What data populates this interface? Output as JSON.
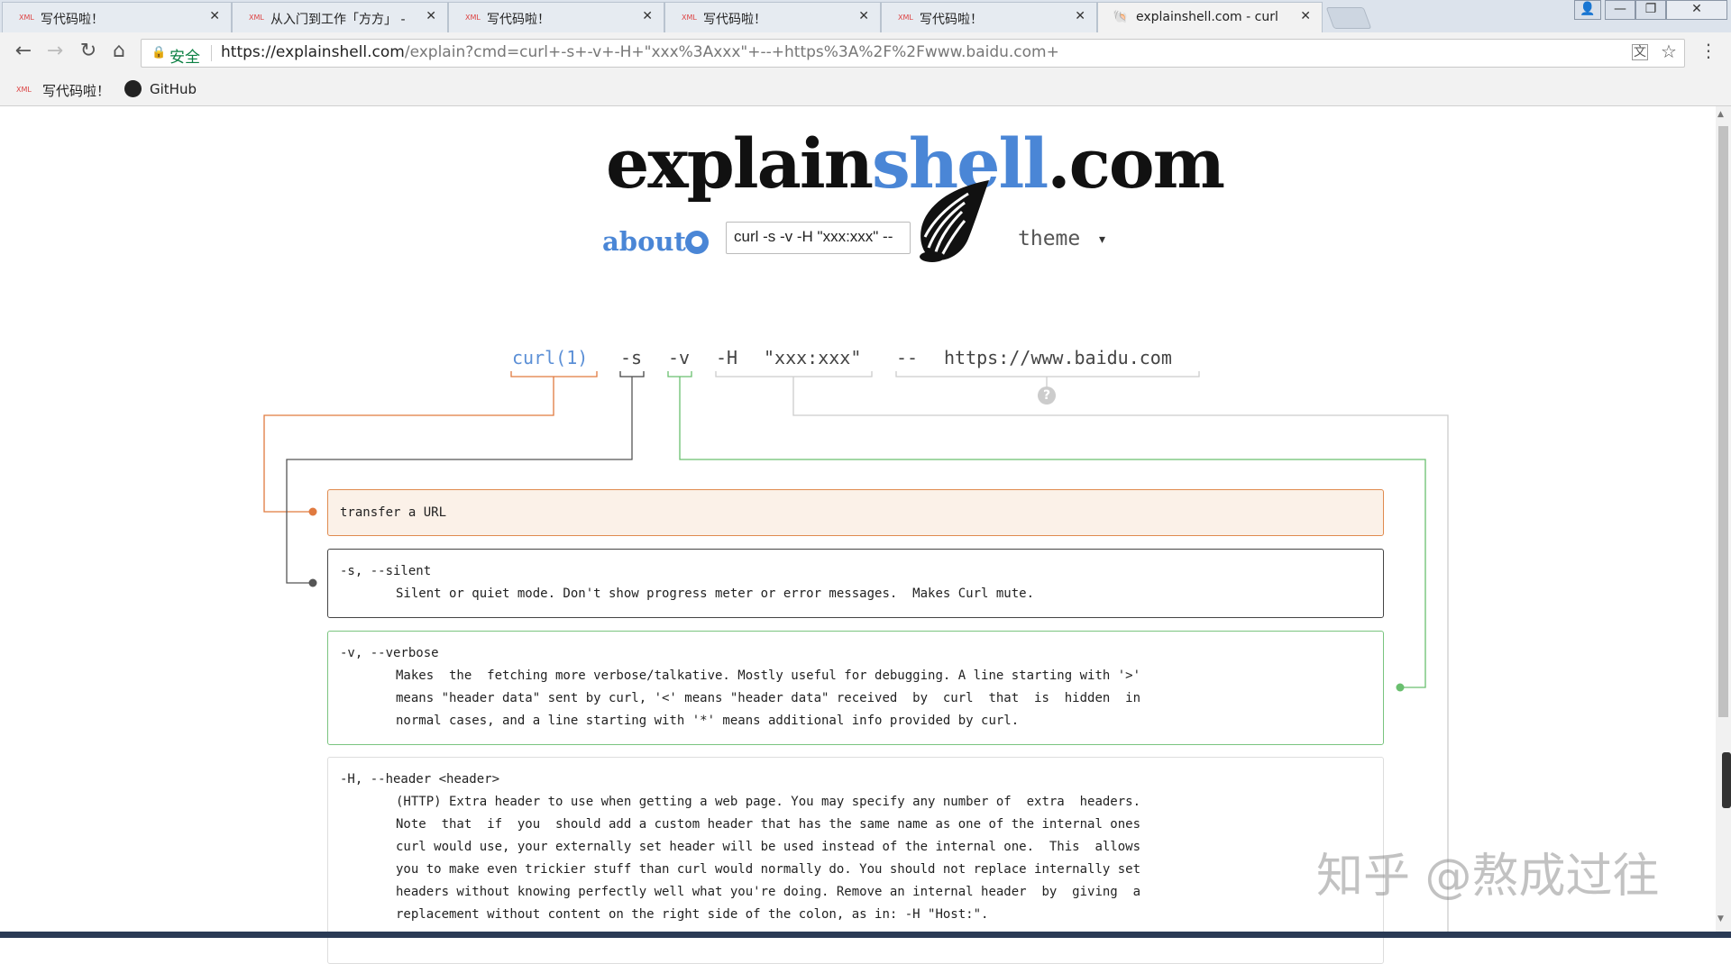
{
  "tabs": [
    {
      "title": "写代码啦！",
      "icon": "xml-icon"
    },
    {
      "title": "从入门到工作「方方」 -",
      "icon": "xml-icon"
    },
    {
      "title": "写代码啦！",
      "icon": "xml-icon"
    },
    {
      "title": "写代码啦！",
      "icon": "xml-icon"
    },
    {
      "title": "写代码啦！",
      "icon": "xml-icon"
    },
    {
      "title": "explainshell.com - curl",
      "icon": "shell-icon",
      "active": true
    }
  ],
  "tab_close": "✕",
  "favicon_xml": "XML",
  "window": {
    "minimize": "—",
    "maximize": "❐",
    "close": "✕",
    "user": "👤"
  },
  "nav": {
    "back": "←",
    "forward": "→",
    "reload": "↻",
    "home": "⌂"
  },
  "address": {
    "lock": "🔒",
    "secure_label": "安全",
    "url_host": "https://explainshell.com",
    "url_path": "/explain?cmd=curl+-s+-v+-H+\"xxx%3Axxx\"+--+https%3A%2F%2Fwww.baidu.com+"
  },
  "toolbar_icons": {
    "translate": "文",
    "star": "☆",
    "menu": "⋮"
  },
  "bookmarks": [
    {
      "label": "写代码啦！",
      "icon": "xml-icon"
    },
    {
      "label": "GitHub",
      "icon": "github-icon"
    }
  ],
  "site": {
    "logo_explain": "explain",
    "logo_shell": "shell",
    "logo_com": ".com",
    "about": "about",
    "command_input": "curl -s -v -H \"xxx:xxx\" --",
    "theme": "theme",
    "theme_caret": "▾",
    "help": "?"
  },
  "command_tokens": [
    {
      "text": "curl(1)",
      "color": "#e07a3f"
    },
    {
      "text": "-s",
      "color": "#444444"
    },
    {
      "text": "-v",
      "color": "#6abf6f"
    },
    {
      "text": "-H",
      "color": "#cccccc"
    },
    {
      "text": "\"xxx:xxx\"",
      "color": "#cccccc"
    },
    {
      "text": "--",
      "color": "#cccccc"
    },
    {
      "text": "https://www.baidu.com",
      "color": "#cccccc"
    }
  ],
  "explanations": [
    {
      "option": "transfer a URL",
      "lines": []
    },
    {
      "option": "-s, --silent",
      "lines": [
        "Silent or quiet mode. Don't show progress meter or error messages.  Makes Curl mute."
      ]
    },
    {
      "option": "-v, --verbose",
      "lines": [
        "Makes  the  fetching more verbose/talkative. Mostly useful for debugging. A line starting with '>'",
        "means \"header data\" sent by curl, '<' means \"header data\" received  by  curl  that  is  hidden  in",
        "normal cases, and a line starting with '*' means additional info provided by curl."
      ]
    },
    {
      "option": "-H, --header <header>",
      "lines": [
        "(HTTP) Extra header to use when getting a web page. You may specify any number of  extra  headers.",
        "Note  that  if  you  should add a custom header that has the same name as one of the internal ones",
        "curl would use, your externally set header will be used instead of the internal one.  This  allows",
        "you to make even trickier stuff than curl would normally do. You should not replace internally set",
        "headers without knowing perfectly well what you're doing. Remove an internal header  by  giving  a",
        "replacement without content on the right side of the colon, as in: -H \"Host:\"."
      ]
    }
  ],
  "watermark": "知乎 @熬成过往",
  "scroll": {
    "up": "▲",
    "down": "▼"
  }
}
